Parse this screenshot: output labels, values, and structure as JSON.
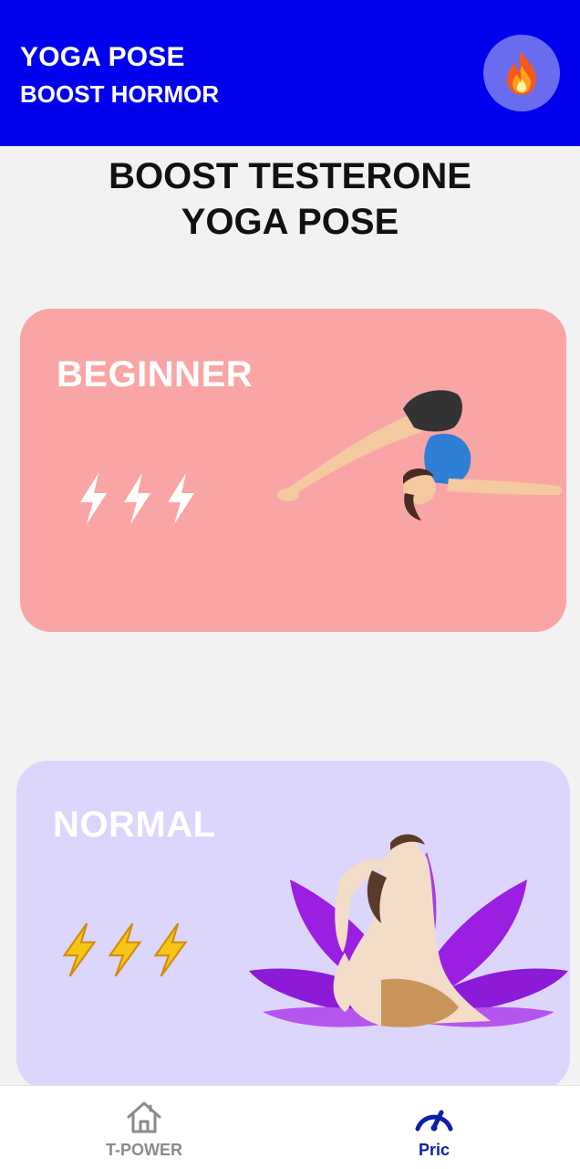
{
  "header": {
    "title": "YOGA POSE",
    "subtitle": "BOOST HORMOR",
    "action_icon": "fire-icon"
  },
  "page": {
    "heading_line1": "BOOST TESTERONE",
    "heading_line2": "YOGA POSE"
  },
  "cards": [
    {
      "label": "BEGINNER",
      "background": "#faa5a5",
      "bolt_color": "#ffffff",
      "bolt_count": 3,
      "illustration": "plow-pose-woman"
    },
    {
      "label": "NORMAL",
      "background": "#dcd6fc",
      "bolt_color": "#f5c518",
      "bolt_count": 3,
      "illustration": "shiva-lotus-yoga-pose"
    }
  ],
  "bottom_nav": {
    "items": [
      {
        "label": "T-POWER",
        "icon": "home-icon",
        "active": false
      },
      {
        "label": "Pric",
        "icon": "speedometer-icon",
        "active": true
      }
    ]
  },
  "colors": {
    "app_bar": "#0000ee",
    "active_nav": "#0b1fa8",
    "inactive_nav": "#8a8a8a"
  }
}
